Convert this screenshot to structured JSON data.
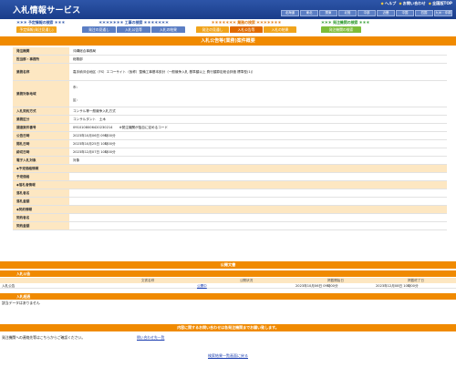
{
  "header": {
    "title": "入札情報サービス",
    "links": [
      "ヘルプ",
      "お問い合わせ",
      "全国版TOP"
    ],
    "regions": [
      "北海道",
      "東北",
      "関東",
      "北陸",
      "中部",
      "近畿",
      "中国",
      "四国",
      "九州・沖縄"
    ]
  },
  "nav": {
    "groups": [
      {
        "title": "＊＊＊ 予定情報の検索 ＊＊＊",
        "tabs": [
          "予定情報(発注見通し)"
        ]
      },
      {
        "title": "＊＊＊＊＊＊＊ 工事の検索 ＊＊＊＊＊＊＊",
        "tabs": [
          "発注の見通し",
          "入札公告等",
          "入札の結果"
        ]
      },
      {
        "title": "＊＊＊＊＊＊＊ 業務の検索 ＊＊＊＊＊＊＊",
        "tabs": [
          "発注の見通し",
          "入札公告等",
          "入札の結果"
        ]
      },
      {
        "title": "＊＊＊ 発注機関の検索 ＊＊＊",
        "tabs": [
          "発注機関の検索"
        ]
      }
    ]
  },
  "page_title": "入札公告等(業務)案件概要",
  "detail": {
    "rows": [
      {
        "label": "発注機関",
        "value": "沖縄総合事務局"
      },
      {
        "label": "担当部・事務所",
        "value": "総務部"
      },
      {
        "label": "業務名称",
        "value": "嘉手納沖合地区（FS）エコーサイト（仮称）整備工事基本設計（一般競争入札 基準額以上 費行額算定総合評価 標準型(1)）"
      },
      {
        "label": "業務対象地域",
        "value_lines": [
          "市：",
          "区："
        ]
      },
      {
        "label": "入札契約方式",
        "value": "コンサル等一般競争入札方式"
      },
      {
        "label": "業務区分",
        "value": "コンサルタント　土木"
      },
      {
        "label": "調達案件番号",
        "value": "0910108006420230214　　※発注機関が独自に定めるコード"
      },
      {
        "label": "公告日時",
        "value": "2023年10月06日 09時00分"
      },
      {
        "label": "開札日時",
        "value": "2023年10月25日 10時00分"
      },
      {
        "label": "締切日時",
        "value": "2023年12月07日 10時00分"
      },
      {
        "label": "電子入札対象",
        "value": "対象"
      }
    ],
    "sections": {
      "schedule": "予定価格情報",
      "winner": "落札者情報",
      "contract": "契約情報"
    },
    "schedule_rows": [
      "予定価格"
    ],
    "winner_rows": [
      "落札者名",
      "落札金額"
    ],
    "contract_rows": [
      "契約者名",
      "契約金額"
    ]
  },
  "public_docs": {
    "title": "公開文書",
    "subhead": "入札公告",
    "headers": [
      "文書名称",
      "公開状況",
      "掲載開始日",
      "掲載終了日"
    ],
    "rows": [
      {
        "name": "入札公告",
        "status": "公開中",
        "start": "2023年10月06日 09時00分",
        "end": "2023年12月08日 10時00分"
      }
    ]
  },
  "results": {
    "subhead": "入札経過",
    "note": "該当データはありません"
  },
  "contact": {
    "bar": "内容に関するお問い合わせは各発注機関までお願い致します。",
    "text": "発注機関への連絡先等はこちらからご確認ください。",
    "link": "問い合わせ先一覧"
  },
  "back_link": "検索結果一覧画面に戻る"
}
